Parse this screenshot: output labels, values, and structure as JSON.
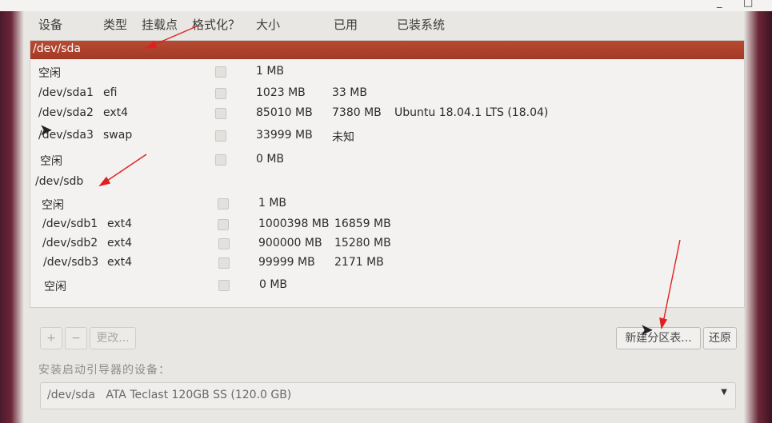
{
  "window": {
    "minimize_glyph": "_",
    "close_glyph": "□"
  },
  "columns": {
    "device": "设备",
    "type": "类型",
    "mount": "挂载点",
    "format": "格式化？",
    "size": "大小",
    "used": "已用",
    "installed": "已装系统"
  },
  "rows": [
    {
      "device": "/dev/sda",
      "type": "",
      "size": "",
      "used": "",
      "system": "",
      "selected": true,
      "has_check": false
    },
    {
      "device": "空闲",
      "type": "",
      "size": "1 MB",
      "used": "",
      "system": "",
      "has_check": true
    },
    {
      "device": "/dev/sda1",
      "type": "efi",
      "size": "1023 MB",
      "used": "33 MB",
      "system": "",
      "has_check": true
    },
    {
      "device": "/dev/sda2",
      "type": "ext4",
      "size": "85010 MB",
      "used": "7380 MB",
      "system": "Ubuntu 18.04.1 LTS (18.04)",
      "has_check": true
    },
    {
      "device": "/dev/sda3",
      "type": "swap",
      "size": "33999 MB",
      "used": "未知",
      "system": "",
      "has_check": true
    },
    {
      "device": "空闲",
      "type": "",
      "size": "0 MB",
      "used": "",
      "system": "",
      "has_check": true
    },
    {
      "device": "/dev/sdb",
      "type": "",
      "size": "",
      "used": "",
      "system": "",
      "has_check": false
    },
    {
      "device": "空闲",
      "type": "",
      "size": "1 MB",
      "used": "",
      "system": "",
      "has_check": true
    },
    {
      "device": "/dev/sdb1",
      "type": "ext4",
      "size": "1000398 MB",
      "used": "16859 MB",
      "system": "",
      "has_check": true
    },
    {
      "device": "/dev/sdb2",
      "type": "ext4",
      "size": "900000 MB",
      "used": "15280 MB",
      "system": "",
      "has_check": true
    },
    {
      "device": "/dev/sdb3",
      "type": "ext4",
      "size": "99999 MB",
      "used": "2171 MB",
      "system": "",
      "has_check": true
    },
    {
      "device": "空闲",
      "type": "",
      "size": "0 MB",
      "used": "",
      "system": "",
      "has_check": true
    }
  ],
  "toolbar": {
    "add": "+",
    "remove": "−",
    "change": "更改...",
    "new_table": "新建分区表...",
    "revert": "还原"
  },
  "bootloader": {
    "label": "安装启动引导器的设备：",
    "device": "/dev/sda",
    "description": "ATA Teclast 120GB SS (120.0 GB)",
    "arrow": "▼"
  },
  "colors": {
    "selected_row": "#a93f2a",
    "annotation_arrow": "#e02020"
  }
}
